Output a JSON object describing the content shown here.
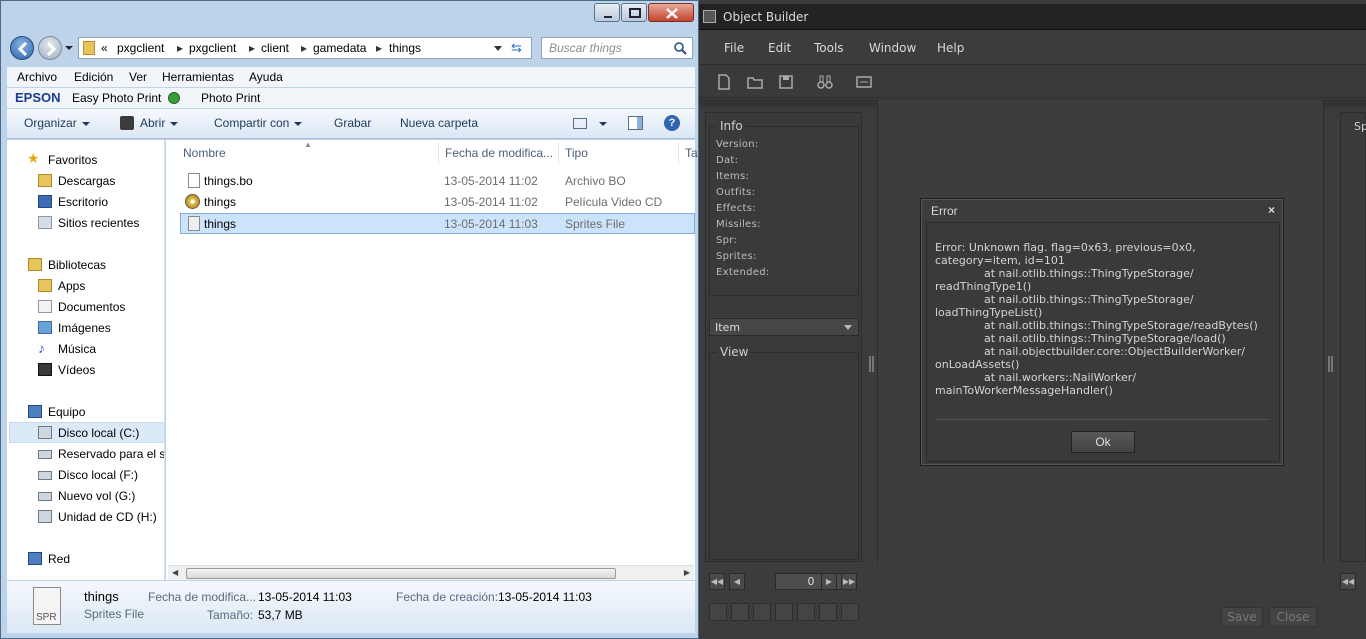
{
  "object_builder": {
    "title": "Object Builder",
    "menu": [
      "File",
      "Edit",
      "Tools",
      "Window",
      "Help"
    ],
    "info": {
      "title": "Info",
      "rows": [
        "Version:",
        "Dat:",
        "Items:",
        "Outfits:",
        "Effects:",
        "Missiles:",
        "Spr:",
        "Sprites:",
        "Extended:"
      ]
    },
    "category_select": "Item",
    "view_title": "View",
    "right_label": "Sp",
    "nav_value": "0",
    "save_label": "Save",
    "close_label": "Close"
  },
  "error_dialog": {
    "title": "Error",
    "close_glyph": "×",
    "message": "Error: Unknown flag. flag=0x63, previous=0x0,\ncategory=item, id=101\n              at nail.otlib.things::ThingTypeStorage/\nreadThingType1()\n              at nail.otlib.things::ThingTypeStorage/\nloadThingTypeList()\n              at nail.otlib.things::ThingTypeStorage/readBytes()\n              at nail.otlib.things::ThingTypeStorage/load()\n              at nail.objectbuilder.core::ObjectBuilderWorker/\nonLoadAssets()\n              at nail.workers::NailWorker/\nmainToWorkerMessageHandler()",
    "ok_label": "Ok"
  },
  "explorer": {
    "breadcrumb": [
      "«",
      "pxgclient",
      "pxgclient",
      "client",
      "gamedata",
      "things"
    ],
    "search_placeholder": "Buscar things",
    "menu": [
      "Archivo",
      "Edición",
      "Ver",
      "Herramientas",
      "Ayuda"
    ],
    "epson": {
      "brand": "EPSON",
      "easy_photo_print": "Easy Photo Print",
      "photo_print": "Photo Print"
    },
    "commands": {
      "organizar": "Organizar",
      "abrir": "Abrir",
      "compartir": "Compartir con",
      "grabar": "Grabar",
      "nueva_carpeta": "Nueva carpeta"
    },
    "nav": {
      "favoritos": "Favoritos",
      "fav_items": [
        "Descargas",
        "Escritorio",
        "Sitios recientes"
      ],
      "bibliotecas": "Bibliotecas",
      "lib_items": [
        "Apps",
        "Documentos",
        "Imágenes",
        "Música",
        "Vídeos"
      ],
      "equipo": "Equipo",
      "drives": [
        "Disco local (C:)",
        "Reservado para el sis",
        "Disco local (F:)",
        "Nuevo vol (G:)",
        "Unidad de CD (H:)"
      ],
      "red": "Red"
    },
    "columns": [
      "Nombre",
      "Fecha de modifica...",
      "Tipo",
      "Ta"
    ],
    "files": [
      {
        "name": "things.bo",
        "date": "13-05-2014 11:02",
        "type": "Archivo BO"
      },
      {
        "name": "things",
        "date": "13-05-2014 11:02",
        "type": "Película Video CD"
      },
      {
        "name": "things",
        "date": "13-05-2014 11:03",
        "type": "Sprites File"
      }
    ],
    "details": {
      "icon_label": "SPR",
      "name": "things",
      "type": "Sprites File",
      "mod_label": "Fecha de modifica...",
      "mod_value": "13-05-2014 11:03",
      "created_label": "Fecha de creación:",
      "created_value": "13-05-2014 11:03",
      "size_label": "Tamaño:",
      "size_value": "53,7 MB"
    }
  }
}
